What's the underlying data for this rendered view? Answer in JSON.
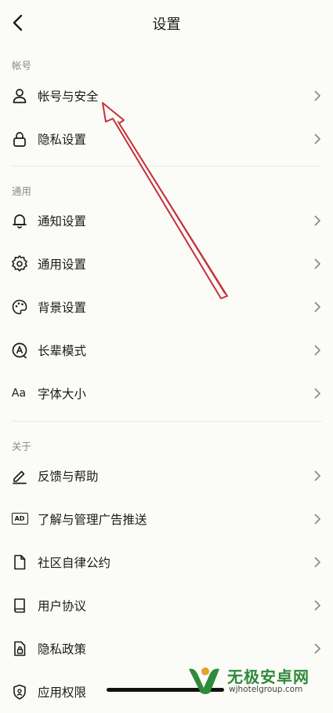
{
  "header": {
    "title": "设置"
  },
  "sections": [
    {
      "label": "帐号",
      "items": [
        {
          "label": "帐号与安全",
          "icon": "user-icon"
        },
        {
          "label": "隐私设置",
          "icon": "lock-icon"
        }
      ]
    },
    {
      "label": "通用",
      "items": [
        {
          "label": "通知设置",
          "icon": "bell-icon"
        },
        {
          "label": "通用设置",
          "icon": "gear-icon"
        },
        {
          "label": "背景设置",
          "icon": "palette-icon"
        },
        {
          "label": "长辈模式",
          "icon": "elder-mode-icon"
        },
        {
          "label": "字体大小",
          "icon": "font-size-icon",
          "icon_text": "Aa"
        }
      ]
    },
    {
      "label": "关于",
      "items": [
        {
          "label": "反馈与帮助",
          "icon": "feedback-pencil-icon"
        },
        {
          "label": "了解与管理广告推送",
          "icon": "ad-icon",
          "icon_text": "AD"
        },
        {
          "label": "社区自律公约",
          "icon": "document-icon"
        },
        {
          "label": "用户协议",
          "icon": "book-icon"
        },
        {
          "label": "隐私政策",
          "icon": "privacy-policy-icon"
        },
        {
          "label": "应用权限",
          "icon": "shield-icon"
        }
      ]
    }
  ],
  "watermark": {
    "name": "无极安卓网",
    "url": "wjhotelgroup.com"
  },
  "colors": {
    "background": "#fbfbf8",
    "text": "#1b1b1b",
    "section_label": "#8a8a8a",
    "chevron": "#8c8c8c",
    "annotation_arrow": "#c6303a",
    "watermark_green": "#2f8a3a"
  }
}
